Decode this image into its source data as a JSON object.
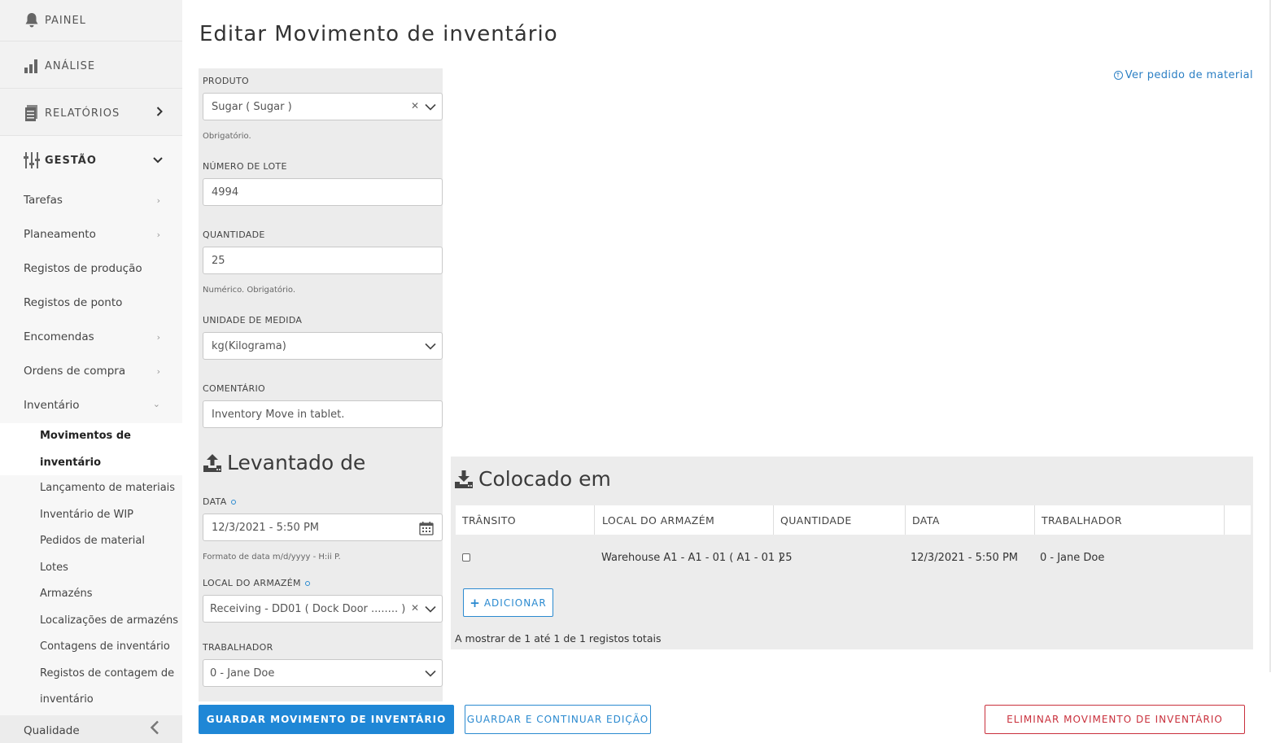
{
  "sidebar": {
    "top_items": [
      {
        "label": "PAINEL",
        "icon": "bell-icon"
      },
      {
        "label": "ANÁLISE",
        "icon": "bar-chart-icon"
      },
      {
        "label": "RELATÓRIOS",
        "icon": "document-icon"
      },
      {
        "label": "GESTÃO",
        "icon": "sliders-icon"
      }
    ],
    "gestao_items": [
      {
        "label": "Tarefas"
      },
      {
        "label": "Planeamento"
      },
      {
        "label": "Registos de produção"
      },
      {
        "label": "Registos de ponto"
      },
      {
        "label": "Encomendas"
      },
      {
        "label": "Ordens de compra"
      },
      {
        "label": "Inventário"
      }
    ],
    "inventario_items": [
      {
        "label": "Movimentos de inventário"
      },
      {
        "label": "Lançamento de materiais"
      },
      {
        "label": "Inventário de WIP"
      },
      {
        "label": "Pedidos de material"
      },
      {
        "label": "Lotes"
      },
      {
        "label": "Armazéns"
      },
      {
        "label": "Localizações de armazéns"
      },
      {
        "label": "Contagens de inventário"
      },
      {
        "label": "Registos de contagem de inventário"
      }
    ],
    "bottom_item": "Qualidade"
  },
  "page": {
    "title": "Editar Movimento de inventário",
    "ver_link": "Ver pedido de material"
  },
  "form": {
    "produto_label": "PRODUTO",
    "produto_value": "Sugar  ( Sugar )",
    "produto_hint": "Obrigatório.",
    "lote_label": "NÚMERO DE LOTE",
    "lote_value": "4994",
    "quantidade_label": "QUANTIDADE",
    "quantidade_value": "25",
    "quantidade_hint": "Numérico. Obrigatório.",
    "unidade_label": "UNIDADE DE MEDIDA",
    "unidade_value": "kg(Kilograma)",
    "comentario_label": "COMENTÁRIO",
    "comentario_value": "Inventory Move in tablet."
  },
  "levantado": {
    "title": "Levantado de",
    "data_label": "DATA",
    "data_value": "12/3/2021 - 5:50 PM",
    "data_hint": "Formato de data m/d/yyyy - H:ii P.",
    "local_label": "LOCAL DO ARMAZÉM",
    "local_value": "Receiving - DD01 ( Dock Door ........ )",
    "trabalhador_label": "TRABALHADOR",
    "trabalhador_value": "0 - Jane Doe"
  },
  "colocado": {
    "title": "Colocado em",
    "columns": [
      "TRÂNSITO",
      "LOCAL DO ARMAZÉM",
      "QUANTIDADE",
      "DATA",
      "TRABALHADOR"
    ],
    "rows": [
      {
        "local": "Warehouse A1 - A1 - 01 ( A1 - 01 )",
        "quantidade": "25",
        "data": "12/3/2021 - 5:50 PM",
        "trabalhador": "0 - Jane Doe"
      }
    ],
    "add_label": "ADICIONAR",
    "records_text": "A mostrar de 1 até 1 de 1 registos totais"
  },
  "actions": {
    "save": "GUARDAR MOVIMENTO DE INVENTÁRIO",
    "save_continue": "GUARDAR E CONTINUAR EDIÇÃO",
    "delete": "ELIMINAR MOVIMENTO DE INVENTÁRIO"
  },
  "colors": {
    "primary": "#1f87d6",
    "danger": "#c9303c",
    "link": "#2b7fc4"
  }
}
